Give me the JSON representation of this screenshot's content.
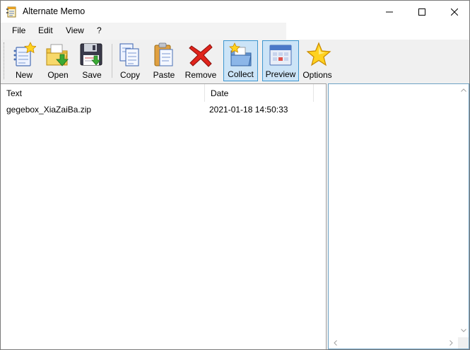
{
  "window": {
    "title": "Alternate Memo"
  },
  "menu": {
    "file": "File",
    "edit": "Edit",
    "view": "View",
    "help": "?"
  },
  "toolbar": {
    "new": "New",
    "open": "Open",
    "save": "Save",
    "copy": "Copy",
    "paste": "Paste",
    "remove": "Remove",
    "collect": "Collect",
    "preview": "Preview",
    "options": "Options"
  },
  "list": {
    "columns": [
      "Text",
      "Date"
    ],
    "rows": [
      {
        "text": "gegebox_XiaZaiBa.zip",
        "date": "2021-01-18 14:50:33"
      }
    ]
  },
  "colors": {
    "toggle_active_bg": "#cce4f7",
    "toggle_active_border": "#3d96cf",
    "preview_border": "#6ea3c5"
  }
}
